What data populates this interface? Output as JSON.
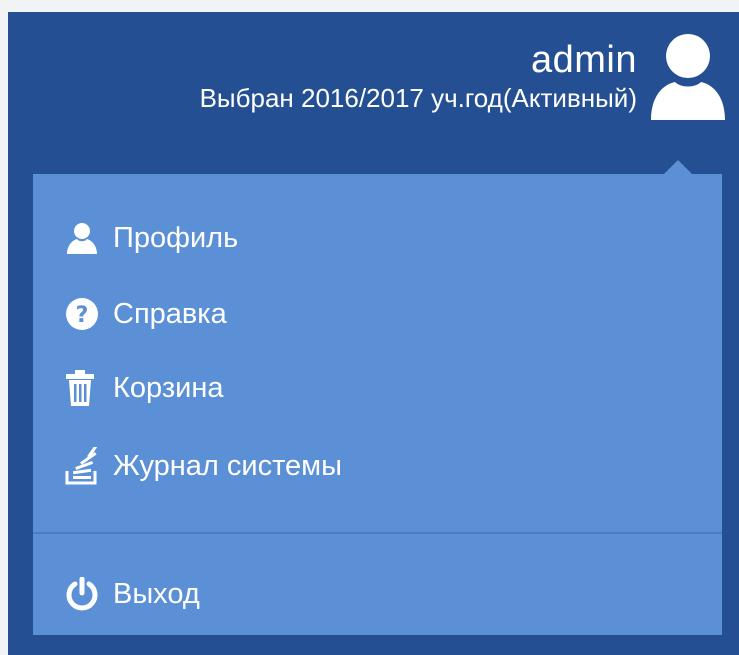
{
  "header": {
    "username": "admin",
    "year_status": "Выбран 2016/2017 уч.год(Активный)",
    "avatar_icon": "user-avatar-icon"
  },
  "menu": {
    "items": [
      {
        "label": "Профиль",
        "icon": "user-icon"
      },
      {
        "label": "Справка",
        "icon": "question-circle-icon"
      },
      {
        "label": "Корзина",
        "icon": "trash-icon"
      },
      {
        "label": "Журнал системы",
        "icon": "stack-log-icon"
      }
    ],
    "logout": {
      "label": "Выход",
      "icon": "power-icon"
    }
  },
  "colors": {
    "frame_bg": "#245093",
    "dropdown_bg": "#5b8fd6",
    "divider": "#4a7cc4",
    "text": "#ffffff"
  }
}
